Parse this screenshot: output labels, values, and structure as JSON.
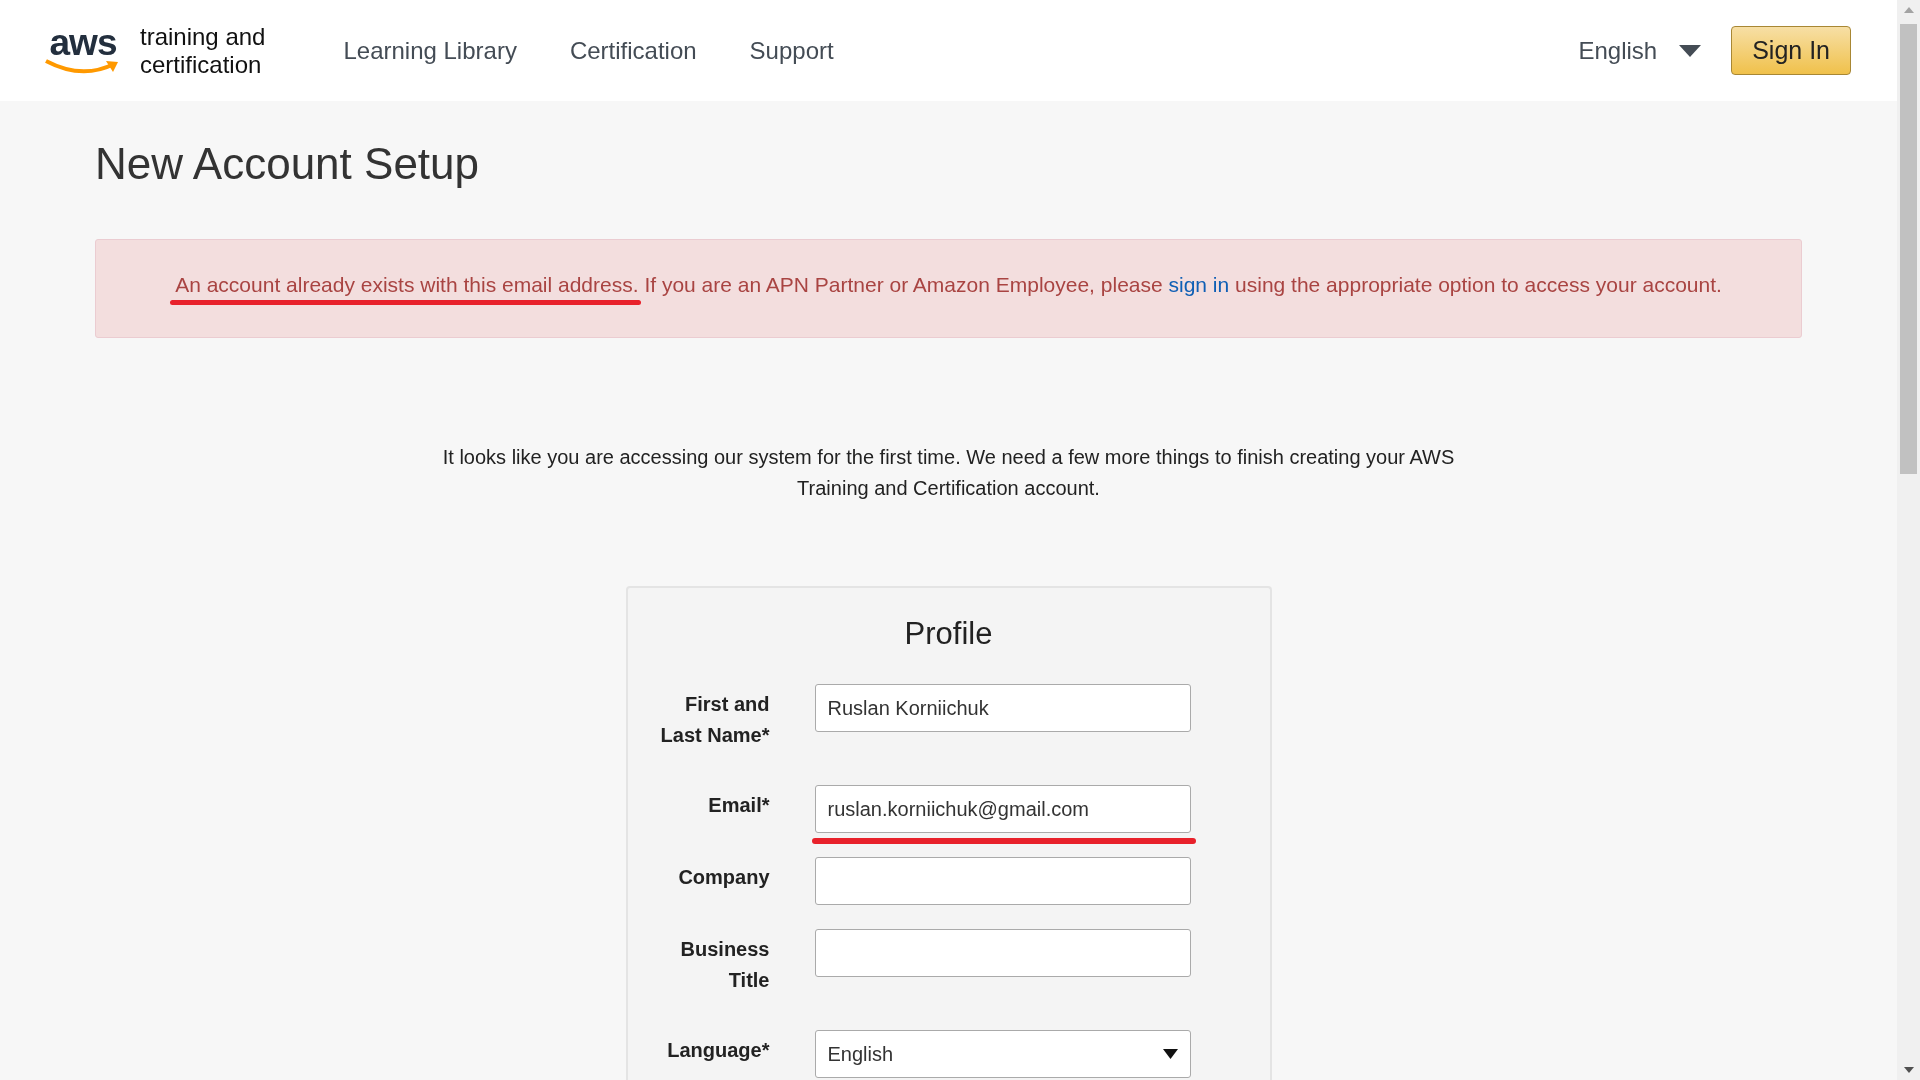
{
  "header": {
    "logo": {
      "mark": "aws",
      "line_1": "training and",
      "line_2": "certification"
    },
    "nav": [
      {
        "label": "Learning Library"
      },
      {
        "label": "Certification"
      },
      {
        "label": "Support"
      }
    ],
    "language": "English",
    "sign_in": "Sign In"
  },
  "title": "New Account Setup",
  "alert": {
    "lead": "An account already exists with this email address.",
    "lead_annotated": true,
    "text_before": " If you are an APN Partner or Amazon Employee, please ",
    "link": "sign in",
    "text_after": " using the appropriate option to access your account."
  },
  "intro": "It looks like you are accessing our system for the first time. We need a few more things to finish creating your AWS Training and Certification account.",
  "profile": {
    "title": "Profile",
    "fields": [
      {
        "kind": "text",
        "label": "First and Last Name*",
        "value": "Ruslan Korniichuk",
        "annotated": false
      },
      {
        "kind": "text",
        "label": "Email*",
        "value": "ruslan.korniichuk@gmail.com",
        "annotated": true
      },
      {
        "kind": "text",
        "label": "Company",
        "annotated": false
      },
      {
        "kind": "text",
        "label": "Business Title",
        "annotated": false
      },
      {
        "kind": "select",
        "label": "Language*",
        "value": "English",
        "annotated": false
      }
    ]
  }
}
